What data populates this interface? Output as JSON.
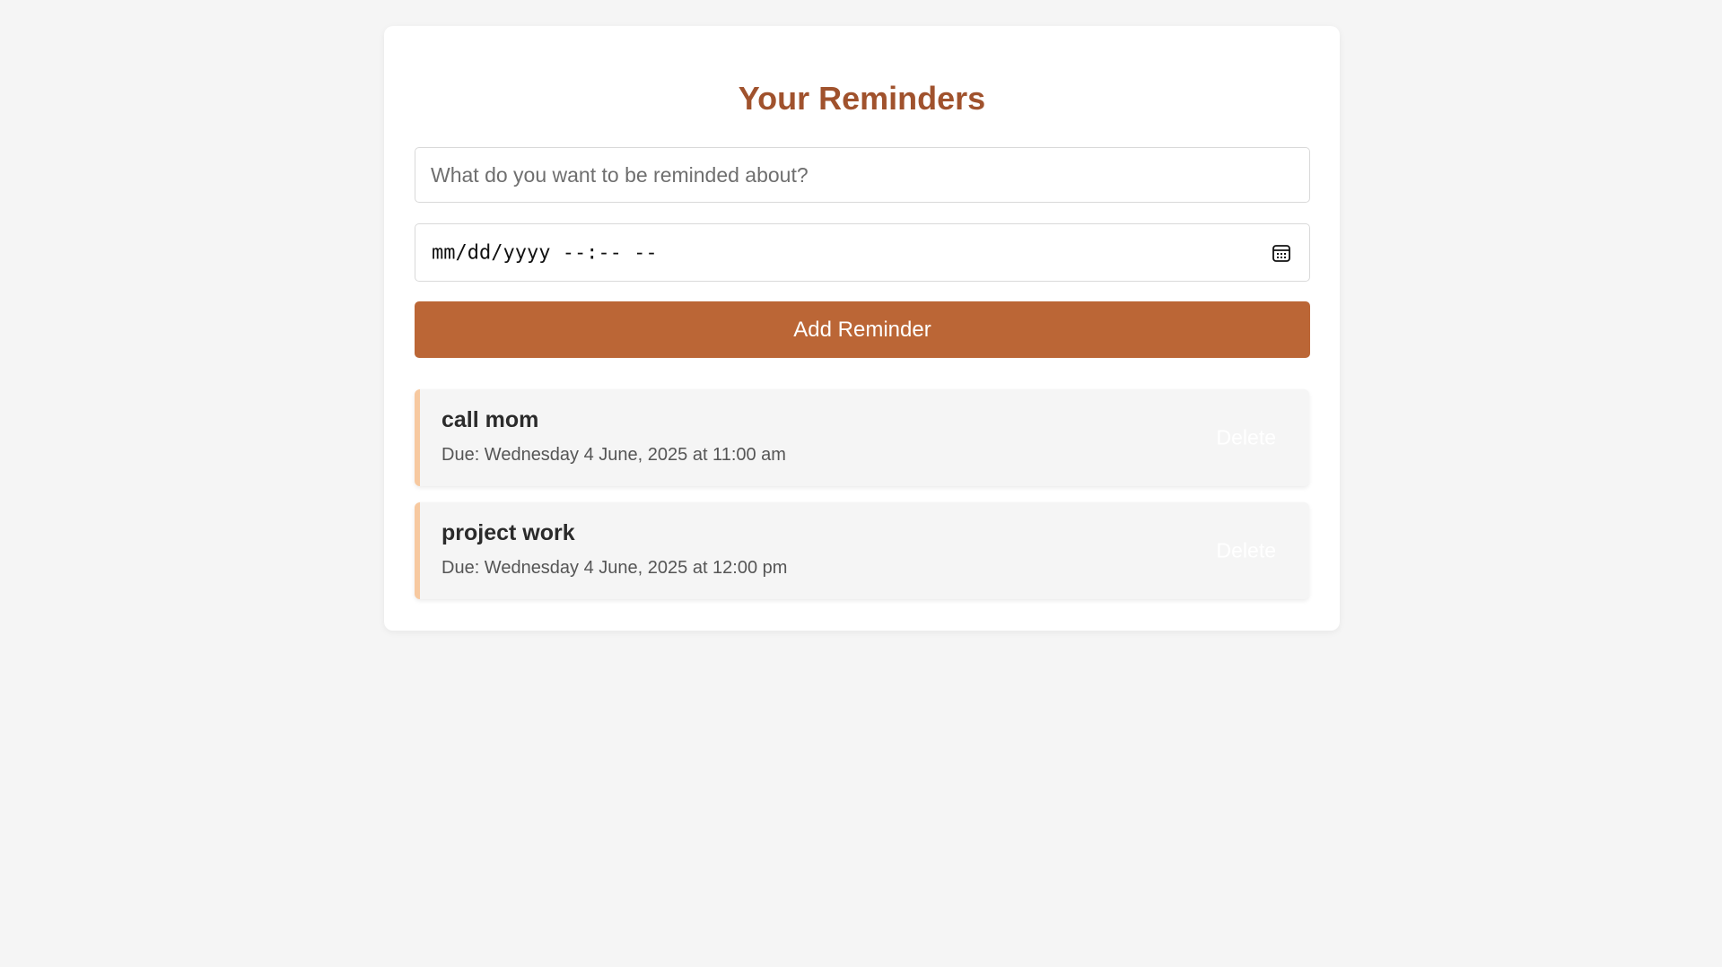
{
  "header": {
    "title": "Your Reminders"
  },
  "form": {
    "reminder_placeholder": "What do you want to be reminded about?",
    "reminder_value": "",
    "datetime_placeholder": "mm/dd/yyyy --:-- --",
    "calendar_icon": "calendar-icon",
    "add_button_label": "Add Reminder"
  },
  "reminders": [
    {
      "title": "call mom",
      "due": "Due: Wednesday 4 June, 2025 at 11:00 am",
      "delete_label": "Delete"
    },
    {
      "title": "project work",
      "due": "Due: Wednesday 4 June, 2025 at 12:00 pm",
      "delete_label": "Delete"
    }
  ],
  "colors": {
    "background": "#f5f5f5",
    "card": "#ffffff",
    "title": "#a0522d",
    "accent_button": "#bb6636",
    "reminder_border": "#f7c9a0",
    "reminder_bg": "#f5f5f5"
  }
}
